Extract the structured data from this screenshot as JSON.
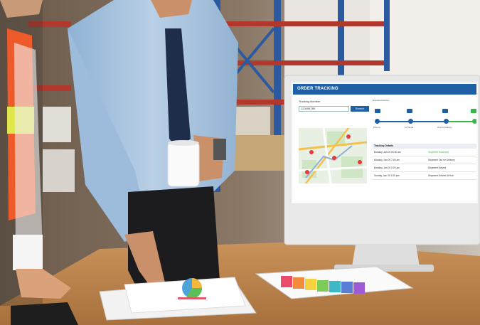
{
  "scene": {
    "description_icons": [
      "warehouse-shelves",
      "person-in-safety-vest",
      "businessman-with-mug",
      "desktop-monitor",
      "printed-charts",
      "tablet"
    ]
  },
  "screen": {
    "title": "ORDER TRACKING",
    "tracking_label": "Tracking Number",
    "tracking_value": "123456789",
    "search_button": "Search",
    "expected_label": "Expected delivery",
    "steps": [
      {
        "label": "Pick up",
        "icon": "box-icon"
      },
      {
        "label": "In Transit",
        "icon": "truck-icon"
      },
      {
        "label": "Out for Delivery",
        "icon": "scooter-icon"
      },
      {
        "label": "Delivered",
        "icon": "check-icon"
      }
    ],
    "details_title": "Tracking Details",
    "details": [
      {
        "date": "Monday, Jan 00 00:00 am",
        "status": "Shipment Delivered",
        "highlight": true
      },
      {
        "date": "Monday, Jan 00 7:00 am",
        "status": "Shipment Out for Delivery",
        "highlight": false
      },
      {
        "date": "Monday, Jan 00 0:00 am",
        "status": "Shipment Arrived",
        "highlight": false
      },
      {
        "date": "Sunday, Jan 00 1:00 pm",
        "status": "Shipment Arrived At Hub",
        "highlight": false
      }
    ],
    "colors": {
      "brand": "#1f5fa3",
      "success": "#39b54a"
    }
  }
}
